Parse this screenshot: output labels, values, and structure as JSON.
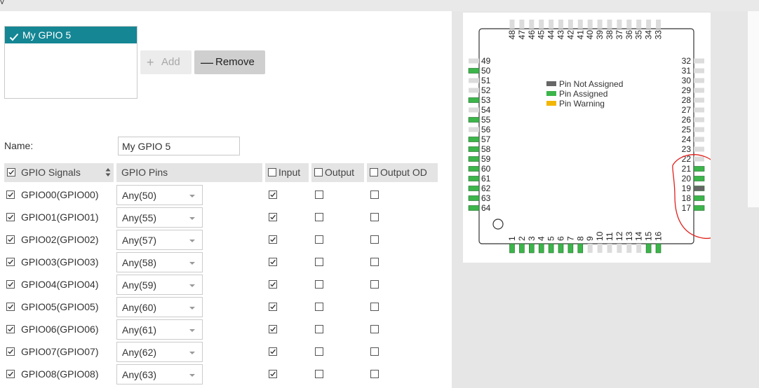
{
  "instances": {
    "items": [
      {
        "label": "My GPIO 5",
        "selected": true
      }
    ]
  },
  "buttons": {
    "add_label": "Add",
    "add_icon": "plus-icon",
    "remove_label": "Remove",
    "remove_icon": "minus-icon"
  },
  "form": {
    "name_label": "Name:",
    "name_value": "My GPIO 5"
  },
  "table": {
    "headers": {
      "signals": "GPIO Signals",
      "pins": "GPIO Pins",
      "input": "Input",
      "output": "Output",
      "output_od": "Output OD"
    },
    "rows": [
      {
        "signal": "GPIO00(GPIO00)",
        "pin": "Any(50)",
        "input": true,
        "output": false,
        "output_od": false
      },
      {
        "signal": "GPIO01(GPIO01)",
        "pin": "Any(55)",
        "input": true,
        "output": false,
        "output_od": false
      },
      {
        "signal": "GPIO02(GPIO02)",
        "pin": "Any(57)",
        "input": true,
        "output": false,
        "output_od": false
      },
      {
        "signal": "GPIO03(GPIO03)",
        "pin": "Any(58)",
        "input": true,
        "output": false,
        "output_od": false
      },
      {
        "signal": "GPIO04(GPIO04)",
        "pin": "Any(59)",
        "input": true,
        "output": false,
        "output_od": false
      },
      {
        "signal": "GPIO05(GPIO05)",
        "pin": "Any(60)",
        "input": true,
        "output": false,
        "output_od": false
      },
      {
        "signal": "GPIO06(GPIO06)",
        "pin": "Any(61)",
        "input": true,
        "output": false,
        "output_od": false
      },
      {
        "signal": "GPIO07(GPIO07)",
        "pin": "Any(62)",
        "input": true,
        "output": false,
        "output_od": false
      },
      {
        "signal": "GPIO08(GPIO08)",
        "pin": "Any(63)",
        "input": true,
        "output": false,
        "output_od": false
      }
    ]
  },
  "chip": {
    "legend": [
      {
        "label": "Pin Not Assigned",
        "color": "#666666"
      },
      {
        "label": "Pin Assigned",
        "color": "#3cb54a"
      },
      {
        "label": "Pin Warning",
        "color": "#f2b705"
      }
    ],
    "colors": {
      "unassigned_pad": "#dcdcdc",
      "not_assigned": "#666666",
      "assigned": "#3cb54a",
      "annotation": "#e0201b"
    },
    "bottom_pins": [
      {
        "label": "1",
        "state": "assigned"
      },
      {
        "label": "2",
        "state": "assigned"
      },
      {
        "label": "3",
        "state": "assigned"
      },
      {
        "label": "4",
        "state": "assigned"
      },
      {
        "label": "5",
        "state": "assigned"
      },
      {
        "label": "6",
        "state": "assigned"
      },
      {
        "label": "7",
        "state": "assigned"
      },
      {
        "label": "8",
        "state": "assigned"
      },
      {
        "label": "9",
        "state": "none"
      },
      {
        "label": "10",
        "state": "none"
      },
      {
        "label": "11",
        "state": "none"
      },
      {
        "label": "12",
        "state": "none"
      },
      {
        "label": "13",
        "state": "none"
      },
      {
        "label": "14",
        "state": "none"
      },
      {
        "label": "15",
        "state": "assigned"
      },
      {
        "label": "16",
        "state": "assigned"
      }
    ],
    "right_pins": [
      {
        "label": "17",
        "state": "assigned"
      },
      {
        "label": "18",
        "state": "assigned"
      },
      {
        "label": "19",
        "state": "not_assigned"
      },
      {
        "label": "20",
        "state": "assigned"
      },
      {
        "label": "21",
        "state": "assigned"
      },
      {
        "label": "22",
        "state": "none"
      },
      {
        "label": "23",
        "state": "none"
      },
      {
        "label": "24",
        "state": "none"
      },
      {
        "label": "25",
        "state": "none"
      },
      {
        "label": "26",
        "state": "none"
      },
      {
        "label": "27",
        "state": "none"
      },
      {
        "label": "28",
        "state": "none"
      },
      {
        "label": "29",
        "state": "none"
      },
      {
        "label": "30",
        "state": "none"
      },
      {
        "label": "31",
        "state": "none"
      },
      {
        "label": "32",
        "state": "none"
      }
    ],
    "top_pins": [
      {
        "label": "33",
        "state": "none"
      },
      {
        "label": "34",
        "state": "none"
      },
      {
        "label": "35",
        "state": "none"
      },
      {
        "label": "36",
        "state": "none"
      },
      {
        "label": "37",
        "state": "none"
      },
      {
        "label": "38",
        "state": "none"
      },
      {
        "label": "39",
        "state": "none"
      },
      {
        "label": "40",
        "state": "none"
      },
      {
        "label": "41",
        "state": "none"
      },
      {
        "label": "42",
        "state": "none"
      },
      {
        "label": "43",
        "state": "none"
      },
      {
        "label": "44",
        "state": "none"
      },
      {
        "label": "45",
        "state": "none"
      },
      {
        "label": "46",
        "state": "none"
      },
      {
        "label": "47",
        "state": "none"
      },
      {
        "label": "48",
        "state": "none"
      }
    ],
    "left_pins": [
      {
        "label": "49",
        "state": "none"
      },
      {
        "label": "50",
        "state": "assigned"
      },
      {
        "label": "51",
        "state": "none"
      },
      {
        "label": "52",
        "state": "none"
      },
      {
        "label": "53",
        "state": "assigned"
      },
      {
        "label": "54",
        "state": "none"
      },
      {
        "label": "55",
        "state": "assigned"
      },
      {
        "label": "56",
        "state": "none"
      },
      {
        "label": "57",
        "state": "assigned"
      },
      {
        "label": "58",
        "state": "assigned"
      },
      {
        "label": "59",
        "state": "assigned"
      },
      {
        "label": "60",
        "state": "assigned"
      },
      {
        "label": "61",
        "state": "assigned"
      },
      {
        "label": "62",
        "state": "assigned"
      },
      {
        "label": "63",
        "state": "assigned"
      },
      {
        "label": "64",
        "state": "assigned"
      }
    ]
  }
}
